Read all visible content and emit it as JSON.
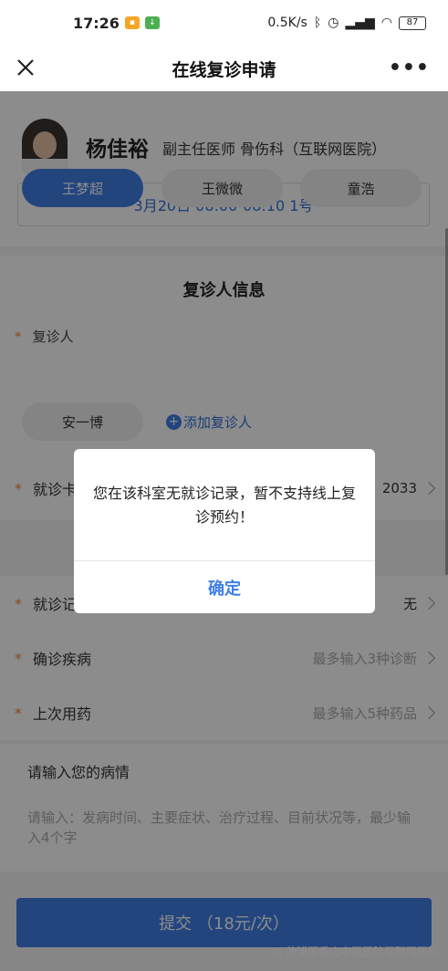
{
  "status_bar": {
    "time": "17:26",
    "net_speed": "0.5K/s",
    "battery": "87"
  },
  "nav": {
    "title": "在线复诊申请",
    "more": "•••"
  },
  "doctor": {
    "name": "杨佳裕",
    "title": "副主任医师 骨伤科（互联网医院）",
    "slot": "3月20日 08:00-08:10 1号"
  },
  "patient_section": {
    "title": "复诊人信息",
    "label": "复诊人",
    "required_mark": "*",
    "patients": [
      "王梦超",
      "王微微",
      "童浩",
      "安一博"
    ],
    "selected": "王梦超",
    "add_label": "添加复诊人"
  },
  "form": {
    "card": {
      "label": "就诊卡",
      "value": "2033"
    },
    "record": {
      "label": "就诊记",
      "value": "无"
    },
    "diagnosis": {
      "label": "确诊疾病",
      "placeholder": "最多输入3种诊断"
    },
    "medication": {
      "label": "上次用药",
      "placeholder": "最多输入5种药品"
    },
    "condition_title": "请输入您的病情",
    "condition_placeholder": "请输入：发病时间、主要症状、治疗过程、目前状况等，最少输入4个字"
  },
  "submit_label": "提交 （18元/次）",
  "watermark": "黄浦区香山中医医院互联网医院",
  "dialog": {
    "message": "您在该科室无就诊记录，暂不支持线上复诊预约！",
    "confirm": "确定"
  },
  "colors": {
    "accent": "#3f7ee6",
    "required": "#f08a3c",
    "overlay": "rgba(0,0,0,0.45)"
  }
}
